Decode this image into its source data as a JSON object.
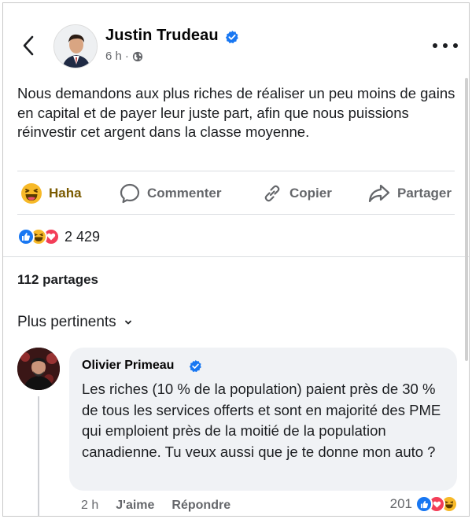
{
  "post": {
    "author": "Justin Trudeau",
    "time": "6 h",
    "separator": "·",
    "text": "Nous demandons aux plus riches de réaliser un peu moins de gains en capital et de payer leur juste part, afin que nous puissions réinvestir cet argent dans la classe moyenne.",
    "selected_reaction": "Haha",
    "actions": {
      "comment": "Commenter",
      "copy": "Copier",
      "share": "Partager"
    },
    "reaction_icons": [
      "like-icon",
      "haha-icon",
      "love-icon"
    ],
    "reaction_count": "2 429",
    "shares": "112 partages"
  },
  "comments": {
    "sort_label": "Plus pertinents",
    "items": [
      {
        "author": "Olivier Primeau",
        "text": "Les riches (10 % de la population) paient près de 30 % de tous les services offerts et sont en majorité des PME qui emploient près de la moitié de la population canadienne. Tu veux aussi que je te donne mon auto ?",
        "time": "2 h",
        "like_label": "J'aime",
        "reply_label": "Répondre",
        "reaction_count": "201",
        "reaction_icons": [
          "like-icon",
          "love-icon",
          "haha-icon"
        ]
      }
    ]
  },
  "colors": {
    "verified_blue": "#1877f2",
    "like_blue": "#1877f2",
    "love_red": "#f33e58",
    "haha_yellow": "#f7b928",
    "secondary_text": "#65676b"
  }
}
